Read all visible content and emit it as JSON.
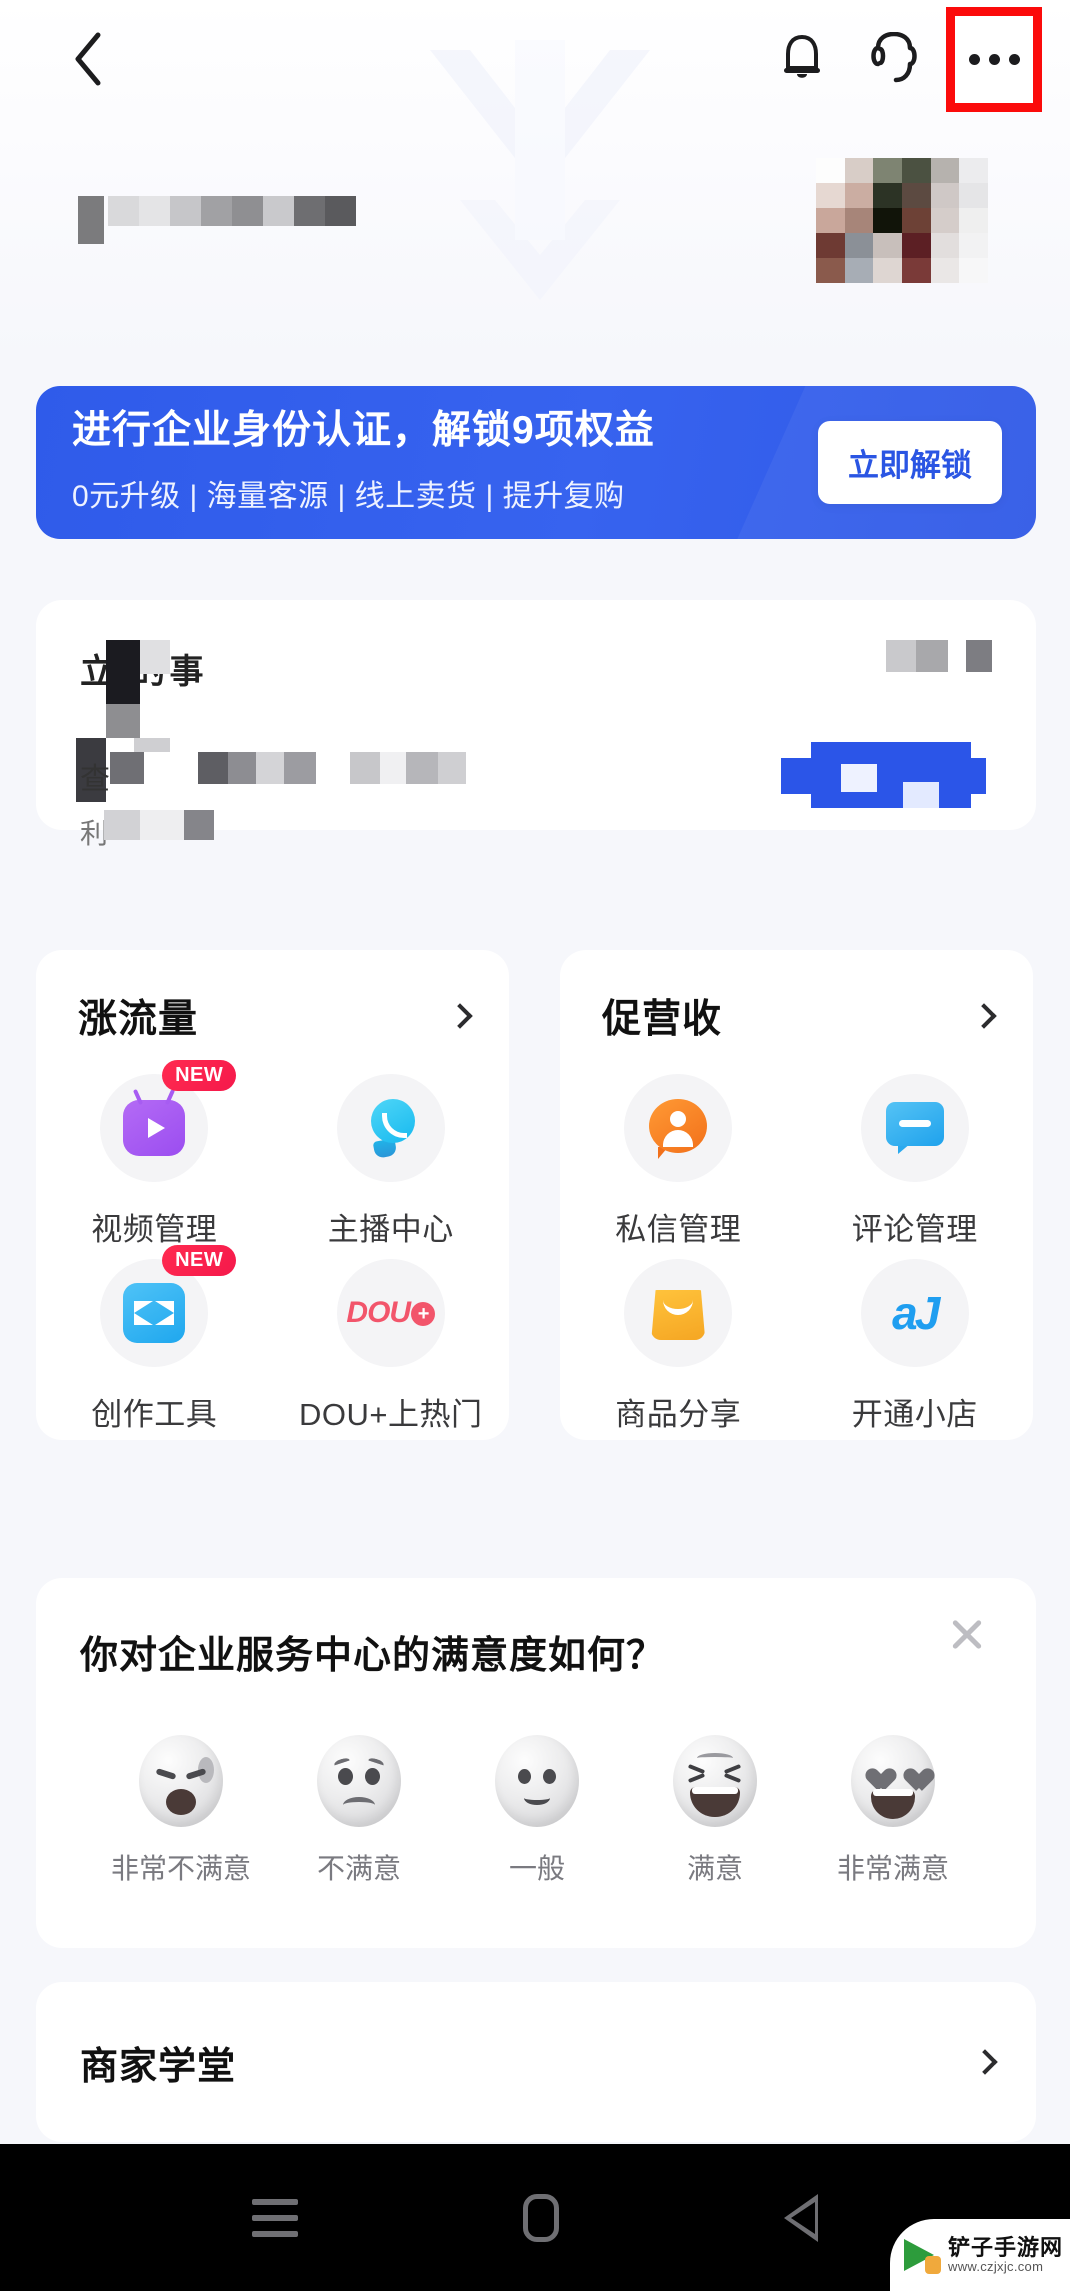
{
  "navbar": {
    "back_icon": "chevron-left",
    "bell_icon": "bell",
    "headset_icon": "headset",
    "more_icon": "ellipsis"
  },
  "profile": {
    "name_redacted": true,
    "subtitle_redacted": true,
    "avatar_redacted": true
  },
  "promo": {
    "title": "进行企业身份认证，解锁9项权益",
    "subtitle": "0元升级 | 海量客源 | 线上卖货 | 提升复购",
    "button_label": "立即解锁",
    "bg_color": "#3763ef",
    "button_text_color": "#2a55e3"
  },
  "masked_card": {
    "line1_partial": "立  的事",
    "line2_partial": "查",
    "line3_partial": "利",
    "redacted": true
  },
  "feature_cards": [
    {
      "title": "涨流量",
      "chevron": "chevron-right",
      "items": [
        {
          "label": "视频管理",
          "icon": "video-manage-icon",
          "badge": "NEW"
        },
        {
          "label": "主播中心",
          "icon": "anchor-center-icon",
          "badge": ""
        },
        {
          "label": "创作工具",
          "icon": "creation-tool-icon",
          "badge": "NEW"
        },
        {
          "label": "DOU+上热门",
          "icon": "dou-plus-icon",
          "badge": ""
        }
      ]
    },
    {
      "title": "促营收",
      "chevron": "chevron-right",
      "items": [
        {
          "label": "私信管理",
          "icon": "private-message-icon",
          "badge": ""
        },
        {
          "label": "评论管理",
          "icon": "comment-manage-icon",
          "badge": ""
        },
        {
          "label": "商品分享",
          "icon": "product-share-icon",
          "badge": ""
        },
        {
          "label": "开通小店",
          "icon": "open-shop-icon",
          "badge": ""
        }
      ]
    }
  ],
  "survey": {
    "title": "你对企业服务中心的满意度如何？",
    "close_icon": "close",
    "options": [
      {
        "label": "非常不满意",
        "face": "very-dissatisfied"
      },
      {
        "label": "不满意",
        "face": "dissatisfied"
      },
      {
        "label": "一般",
        "face": "neutral"
      },
      {
        "label": "满意",
        "face": "satisfied"
      },
      {
        "label": "非常满意",
        "face": "very-satisfied"
      }
    ]
  },
  "school": {
    "title": "商家学堂",
    "chevron": "chevron-right"
  },
  "system_nav": {
    "recent_icon": "recents",
    "home_icon": "home",
    "back_icon": "back"
  },
  "watermark": {
    "name": "铲子手游网",
    "url": "www.czjxjc.com"
  }
}
